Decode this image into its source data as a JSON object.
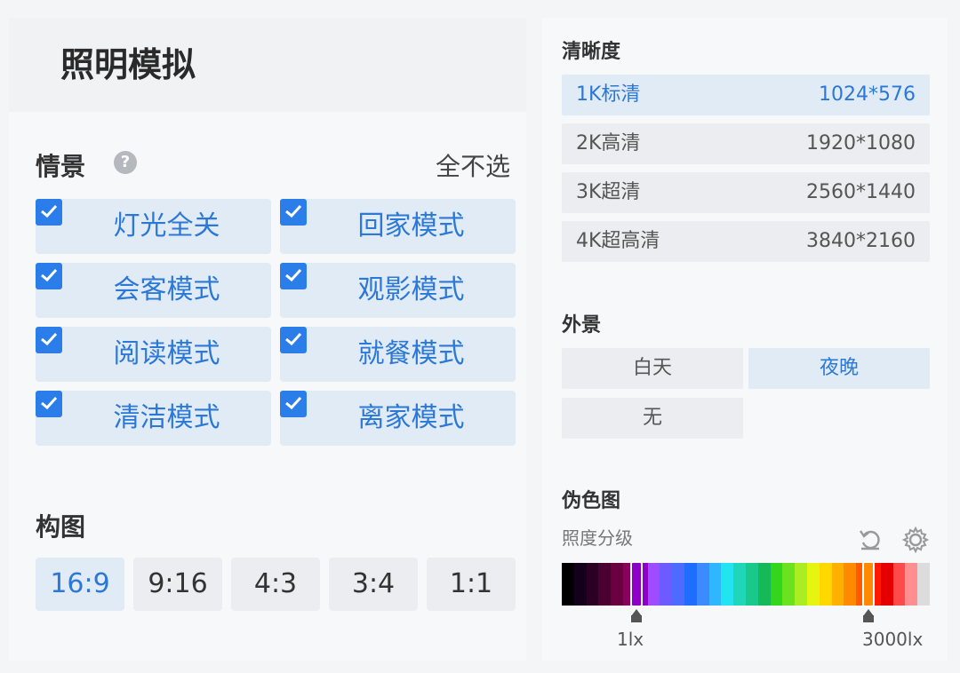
{
  "left": {
    "title": "照明模拟",
    "scene": {
      "label": "情景",
      "help_icon": "question-circle-icon",
      "deselect_all": "全不选",
      "items": [
        {
          "label": "灯光全关",
          "checked": true
        },
        {
          "label": "回家模式",
          "checked": true
        },
        {
          "label": "会客模式",
          "checked": true
        },
        {
          "label": "观影模式",
          "checked": true
        },
        {
          "label": "阅读模式",
          "checked": true
        },
        {
          "label": "就餐模式",
          "checked": true
        },
        {
          "label": "清洁模式",
          "checked": true
        },
        {
          "label": "离家模式",
          "checked": true
        }
      ]
    },
    "composition": {
      "label": "构图",
      "options": [
        "16:9",
        "9:16",
        "4:3",
        "3:4",
        "1:1"
      ],
      "selected": "16:9"
    }
  },
  "right": {
    "resolution": {
      "label": "清晰度",
      "options": [
        {
          "name": "1K标清",
          "size": "1024*576",
          "selected": true
        },
        {
          "name": "2K高清",
          "size": "1920*1080",
          "selected": false
        },
        {
          "name": "3K超清",
          "size": "2560*1440",
          "selected": false
        },
        {
          "name": "4K超高清",
          "size": "3840*2160",
          "selected": false
        }
      ]
    },
    "background": {
      "label": "外景",
      "options": [
        {
          "label": "白天",
          "selected": false
        },
        {
          "label": "夜晚",
          "selected": true
        },
        {
          "label": "无",
          "selected": false
        }
      ]
    },
    "false_color": {
      "label": "伪色图",
      "sub_label": "照度分级",
      "reset_icon": "reset-icon",
      "settings_icon": "gear-icon",
      "range_min": "1lx",
      "range_max": "3000lx",
      "colors": [
        "#000000",
        "#14001a",
        "#2a0024",
        "#4a0031",
        "#6a0040",
        "#8a005c",
        "#8e00c8",
        "#9d4dff",
        "#6e5bff",
        "#4d6bff",
        "#1f6dff",
        "#3b8bff",
        "#2fb6ff",
        "#22e4f0",
        "#1fd6b8",
        "#19c98c",
        "#16b958",
        "#33d61c",
        "#6ae21e",
        "#a8ee22",
        "#e6f50f",
        "#ffd800",
        "#ffb000",
        "#ff8a00",
        "#ff5a00",
        "#ff1a00",
        "#e40000",
        "#ff4a4a",
        "#ff8f8f",
        "#dcdcdc"
      ],
      "accent": "#2b78d6"
    }
  }
}
